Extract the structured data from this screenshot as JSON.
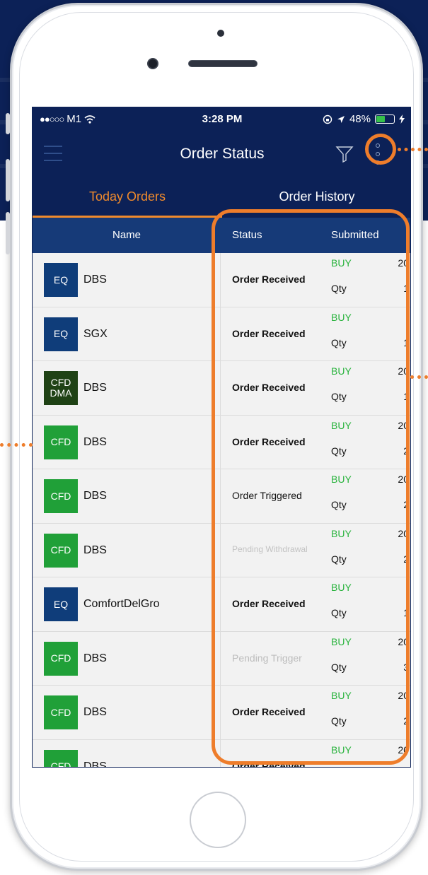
{
  "status_bar": {
    "signal_dots": "●●○○○",
    "carrier": "M1",
    "wifi_icon": "wifi-icon",
    "time": "3:28 PM",
    "battery_percent": "48%",
    "battery_level": 0.48
  },
  "header": {
    "title": "Order Status",
    "menu_icon": "hamburger-menu-icon",
    "filter_icon": "filter-funnel-icon",
    "more_icon": "vertical-more-icon"
  },
  "tabs": [
    {
      "label": "Today Orders",
      "active": true
    },
    {
      "label": "Order History",
      "active": false
    }
  ],
  "columns": {
    "name": "Name",
    "status": "Status",
    "submitted": "Submitted"
  },
  "orders": [
    {
      "badge": "EQ",
      "name": "DBS",
      "status": "Order Received",
      "side": "BUY",
      "qty_label": "Qty",
      "submitted_top": "20",
      "submitted_bottom": "1"
    },
    {
      "badge": "EQ",
      "name": "SGX",
      "status": "Order Received",
      "side": "BUY",
      "qty_label": "Qty",
      "submitted_top": "",
      "submitted_bottom": "1"
    },
    {
      "badge": "CFD DMA",
      "name": "DBS",
      "status": "Order Received",
      "side": "BUY",
      "qty_label": "Qty",
      "submitted_top": "20",
      "submitted_bottom": "1"
    },
    {
      "badge": "CFD",
      "name": "DBS",
      "status": "Order Received",
      "side": "BUY",
      "qty_label": "Qty",
      "submitted_top": "20",
      "submitted_bottom": "2"
    },
    {
      "badge": "CFD",
      "name": "DBS",
      "status": "Order Triggered",
      "side": "BUY",
      "qty_label": "Qty",
      "submitted_top": "20",
      "submitted_bottom": "2"
    },
    {
      "badge": "CFD",
      "name": "DBS",
      "status": "Pending Withdrawal",
      "side": "BUY",
      "qty_label": "Qty",
      "submitted_top": "20",
      "submitted_bottom": "2"
    },
    {
      "badge": "EQ",
      "name": "ComfortDelGro",
      "status": "Order Received",
      "side": "BUY",
      "qty_label": "Qty",
      "submitted_top": "",
      "submitted_bottom": "1"
    },
    {
      "badge": "CFD",
      "name": "DBS",
      "status": "Pending Trigger",
      "side": "BUY",
      "qty_label": "Qty",
      "submitted_top": "20",
      "submitted_bottom": "3"
    },
    {
      "badge": "CFD",
      "name": "DBS",
      "status": "Order Received",
      "side": "BUY",
      "qty_label": "Qty",
      "submitted_top": "20",
      "submitted_bottom": "2"
    },
    {
      "badge": "CFD",
      "name": "DBS",
      "status": "Order Received",
      "side": "BUY",
      "qty_label": "",
      "submitted_top": "20",
      "submitted_bottom": ""
    }
  ],
  "colors": {
    "navy": "#0c2157",
    "header_blue": "#163a78",
    "accent_orange": "#f08a2c",
    "buy_green": "#29b33d",
    "eq_badge": "#0f3d7a",
    "cfd_badge": "#20a038",
    "cfd_dma_badge": "#1f4215",
    "annotation_orange": "#ee7d2b"
  }
}
